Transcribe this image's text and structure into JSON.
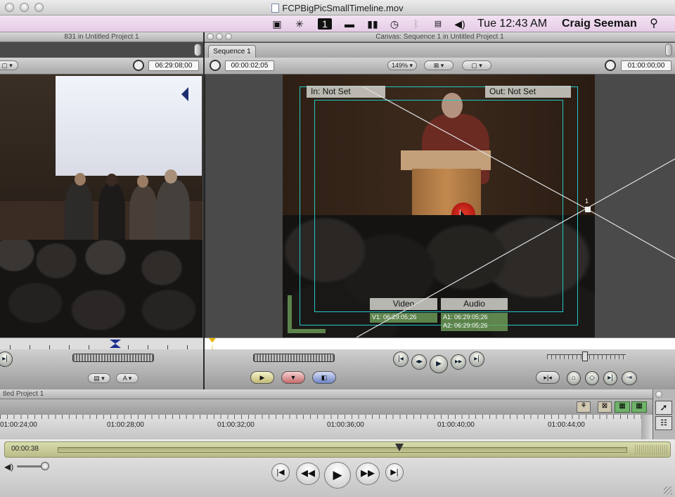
{
  "window": {
    "title": "FCPBigPicSmallTimeline.mov"
  },
  "menubar": {
    "icons": [
      "camera-icon",
      "bluetooth-fan-icon",
      "tv-1-icon",
      "display-icon",
      "battery-icon",
      "time-machine-icon",
      "bluetooth-icon",
      "us-flag-icon",
      "volume-icon"
    ],
    "clock": "Tue 12:43 AM",
    "user": "Craig Seeman"
  },
  "viewer": {
    "title": "831 in Untitled Project 1",
    "duration": "06:29:08;00"
  },
  "canvas": {
    "title": "Canvas: Sequence 1 in Untitled Project 1",
    "tab": "Sequence 1",
    "current_tc": "00:00:02;05",
    "zoom": "149%",
    "duration_tc": "01:00:00;00",
    "in_label": "In: Not Set",
    "out_label": "Out: Not Set",
    "video_label": "Video",
    "audio_label": "Audio",
    "v1": "V1: 06:29:05;26",
    "a1": "A1: 06:29:05;26",
    "a2": "A2: 06:29:05;26",
    "keyframe_num": "1"
  },
  "timeline": {
    "title": "tled Project 1",
    "ruler": [
      "01:00:24;00",
      "01:00:28;00",
      "01:00:32;00",
      "01:00:36;00",
      "01:00:40;00",
      "01:00:44;00"
    ]
  },
  "player": {
    "time": "00:00:38",
    "scrub_fraction": 0.6
  }
}
